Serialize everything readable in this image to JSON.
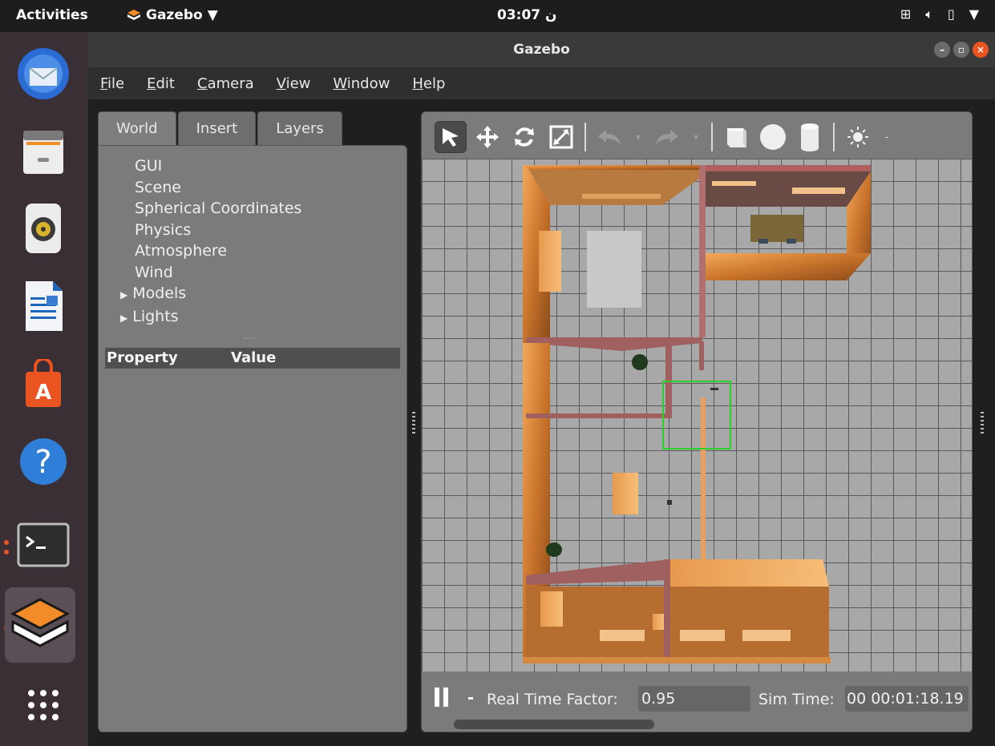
{
  "topbar": {
    "activities": "Activities",
    "app_name": "Gazebo",
    "clock": "03:07 ن"
  },
  "dock": {
    "items": [
      "thunderbird-icon",
      "files-icon",
      "rhythmbox-icon",
      "writer-icon",
      "software-icon",
      "help-icon",
      "terminal-icon",
      "gazebo-icon",
      "app-grid-icon"
    ]
  },
  "window": {
    "title": "Gazebo"
  },
  "menubar": {
    "items": [
      {
        "u": "F",
        "rest": "ile"
      },
      {
        "u": "E",
        "rest": "dit"
      },
      {
        "u": "C",
        "rest": "amera"
      },
      {
        "u": "V",
        "rest": "iew"
      },
      {
        "u": "W",
        "rest": "indow"
      },
      {
        "u": "H",
        "rest": "elp"
      }
    ]
  },
  "left_panel": {
    "tabs": [
      "World",
      "Insert",
      "Layers"
    ],
    "active_tab": "World",
    "tree": [
      "GUI",
      "Scene",
      "Spherical Coordinates",
      "Physics",
      "Atmosphere",
      "Wind",
      "Models",
      "Lights"
    ],
    "property_header": "Property",
    "value_header": "Value"
  },
  "toolbar": {
    "tools": [
      "select-arrow-icon",
      "translate-icon",
      "rotate-icon",
      "scale-icon",
      "undo-icon",
      "redo-icon",
      "box-shape-icon",
      "sphere-shape-icon",
      "cylinder-shape-icon",
      "light-icon"
    ]
  },
  "status": {
    "rtf_label": "Real Time Factor:",
    "rtf_value": "0.95",
    "sim_time_label": "Sim Time:",
    "sim_time_value": "00 00:01:18.19"
  }
}
